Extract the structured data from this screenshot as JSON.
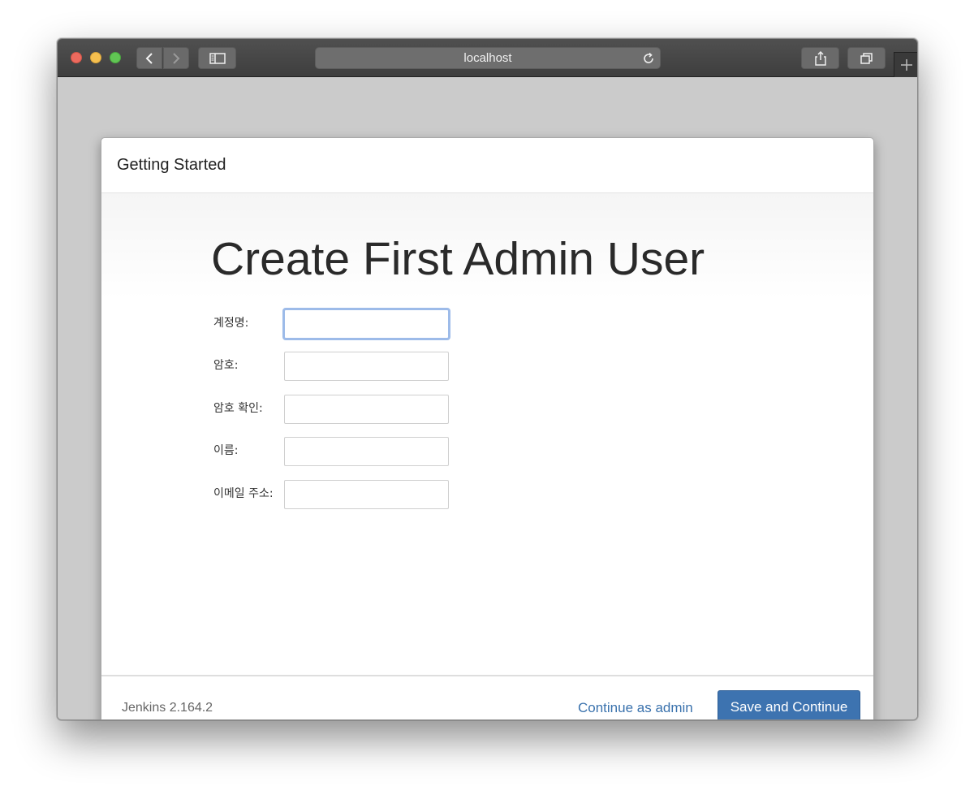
{
  "browser": {
    "url": "localhost",
    "icons": {
      "back": "chevron-left-icon",
      "forward": "chevron-right-icon",
      "sidebar": "sidebar-icon",
      "reload": "reload-icon",
      "share": "share-icon",
      "tabs": "tabs-overview-icon",
      "new_tab": "plus-icon"
    }
  },
  "dialog": {
    "header_title": "Getting Started",
    "heading": "Create First Admin User",
    "fields": [
      {
        "label": "계정명:",
        "value": "",
        "focused": true
      },
      {
        "label": "암호:",
        "value": ""
      },
      {
        "label": "암호 확인:",
        "value": ""
      },
      {
        "label": "이름:",
        "value": ""
      },
      {
        "label": "이메일 주소:",
        "value": ""
      }
    ],
    "footer": {
      "version": "Jenkins 2.164.2",
      "continue_link": "Continue as admin",
      "save_button": "Save and Continue"
    }
  },
  "colors": {
    "primary_button": "#3d73b0",
    "link": "#3a72ad",
    "focus_ring": "#9dbbe9"
  }
}
